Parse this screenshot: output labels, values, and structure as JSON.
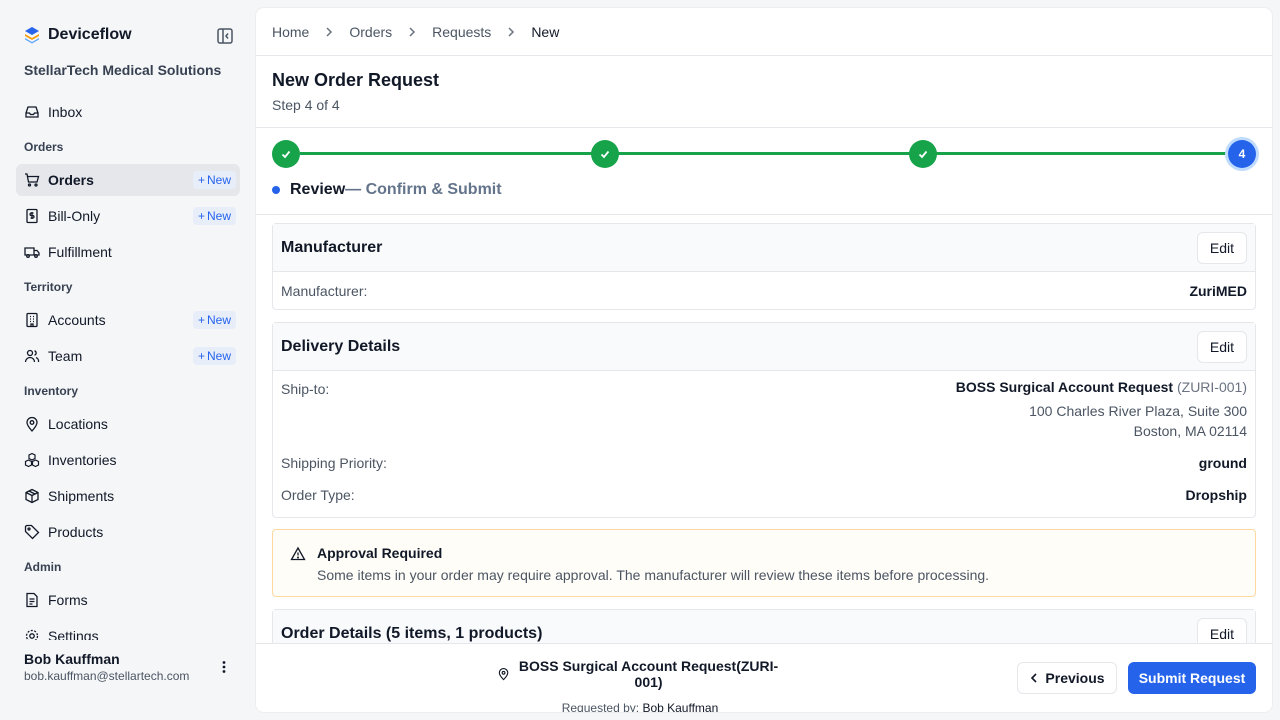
{
  "app": {
    "name": "Deviceflow",
    "org": "StellarTech Medical Solutions"
  },
  "sidebar": {
    "inbox": "Inbox",
    "sections": {
      "orders": "Orders",
      "territory": "Territory",
      "inventory": "Inventory",
      "admin": "Admin"
    },
    "items": {
      "orders": "Orders",
      "bill_only": "Bill-Only",
      "fulfillment": "Fulfillment",
      "accounts": "Accounts",
      "team": "Team",
      "locations": "Locations",
      "inventories": "Inventories",
      "shipments": "Shipments",
      "products": "Products",
      "forms": "Forms",
      "settings": "Settings"
    },
    "new_badge": "New",
    "user": {
      "name": "Bob Kauffman",
      "email": "bob.kauffman@stellartech.com"
    }
  },
  "breadcrumb": [
    "Home",
    "Orders",
    "Requests",
    "New"
  ],
  "page": {
    "title": "New Order Request",
    "subtitle": "Step 4 of 4"
  },
  "stepper": {
    "current_step_number": "4",
    "current_label": "Review",
    "current_desc": "— Confirm & Submit"
  },
  "manufacturer_card": {
    "title": "Manufacturer",
    "edit": "Edit",
    "label": "Manufacturer:",
    "value": "ZuriMED"
  },
  "delivery_card": {
    "title": "Delivery Details",
    "edit": "Edit",
    "ship_to_label": "Ship-to:",
    "ship_to_name": "BOSS Surgical Account Request",
    "ship_to_code": "(ZURI-001)",
    "address_line1": "100 Charles River Plaza, Suite 300",
    "address_line2": "Boston, MA 02114",
    "priority_label": "Shipping Priority:",
    "priority_value": "ground",
    "type_label": "Order Type:",
    "type_value": "Dropship"
  },
  "alert": {
    "title": "Approval Required",
    "text": "Some items in your order may require approval. The manufacturer will review these items before processing."
  },
  "order_card": {
    "title": "Order Details (5 items, 1 products)",
    "edit": "Edit"
  },
  "footer": {
    "account": "BOSS Surgical Account Request(ZURI-001)",
    "requested_by_label": "Requested by:",
    "requested_by": "Bob Kauffman",
    "previous": "Previous",
    "submit": "Submit Request"
  },
  "colors": {
    "accent": "#2563eb",
    "success": "#16a34a",
    "warning_border": "#fcd9a0"
  }
}
